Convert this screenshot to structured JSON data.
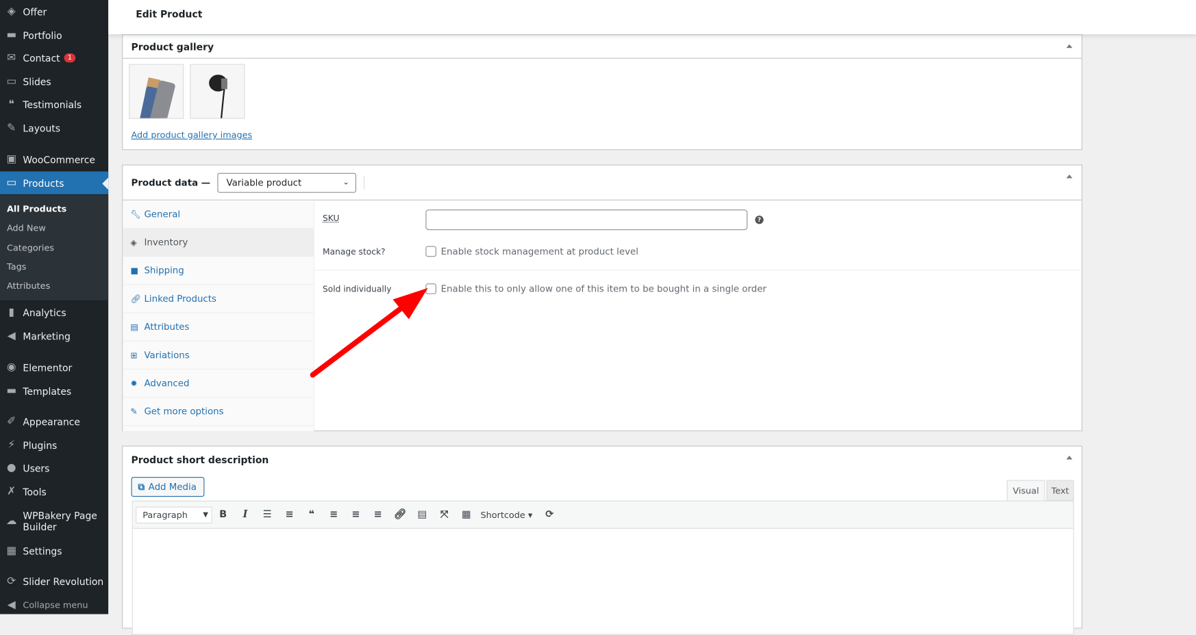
{
  "sidebar": {
    "items": [
      {
        "label": "Offer",
        "icon": "tag-icon"
      },
      {
        "label": "Portfolio",
        "icon": "folder-icon"
      },
      {
        "label": "Contact",
        "icon": "envelope-icon",
        "badge": "1"
      },
      {
        "label": "Slides",
        "icon": "slides-icon"
      },
      {
        "label": "Testimonials",
        "icon": "quote-icon"
      },
      {
        "label": "Layouts",
        "icon": "pencil-icon"
      },
      {
        "label": "WooCommerce",
        "icon": "woo-icon"
      },
      {
        "label": "Products",
        "icon": "archive-icon",
        "active": true
      },
      {
        "label": "Analytics",
        "icon": "bar-chart-icon"
      },
      {
        "label": "Marketing",
        "icon": "megaphone-icon"
      },
      {
        "label": "Elementor",
        "icon": "elementor-icon"
      },
      {
        "label": "Templates",
        "icon": "folder-open-icon"
      },
      {
        "label": "Appearance",
        "icon": "paintbrush-icon"
      },
      {
        "label": "Plugins",
        "icon": "plugin-icon"
      },
      {
        "label": "Users",
        "icon": "user-icon"
      },
      {
        "label": "Tools",
        "icon": "wrench-icon"
      },
      {
        "label": "WPBakery Page Builder",
        "icon": "wpbakery-icon"
      },
      {
        "label": "Settings",
        "icon": "settings-icon"
      },
      {
        "label": "Slider Revolution",
        "icon": "refresh-icon"
      },
      {
        "label": "Collapse menu",
        "icon": "collapse-icon"
      }
    ],
    "submenu": [
      "All Products",
      "Add New",
      "Categories",
      "Tags",
      "Attributes"
    ]
  },
  "header": {
    "title": "Edit Product"
  },
  "gallery": {
    "title": "Product gallery",
    "add_link": "Add product gallery images"
  },
  "product_data": {
    "title": "Product data —",
    "type": "Variable product",
    "tabs": [
      "General",
      "Inventory",
      "Shipping",
      "Linked Products",
      "Attributes",
      "Variations",
      "Advanced",
      "Get more options"
    ],
    "active_tab": "Inventory",
    "sku_label": "SKU",
    "sku_value": "",
    "manage_stock_label": "Manage stock?",
    "manage_stock_desc": "Enable stock management at product level",
    "manage_stock_checked": false,
    "sold_individually_label": "Sold individually",
    "sold_individually_desc": "Enable this to only allow one of this item to be bought in a single order",
    "sold_individually_checked": false
  },
  "short_desc": {
    "title": "Product short description",
    "add_media": "Add Media",
    "tab_visual": "Visual",
    "tab_text": "Text",
    "format": "Paragraph",
    "shortcode": "Shortcode ▾"
  },
  "colors": {
    "accent": "#2271b1",
    "sidebar": "#1d2327",
    "annotation_arrow": "#ff0000"
  }
}
